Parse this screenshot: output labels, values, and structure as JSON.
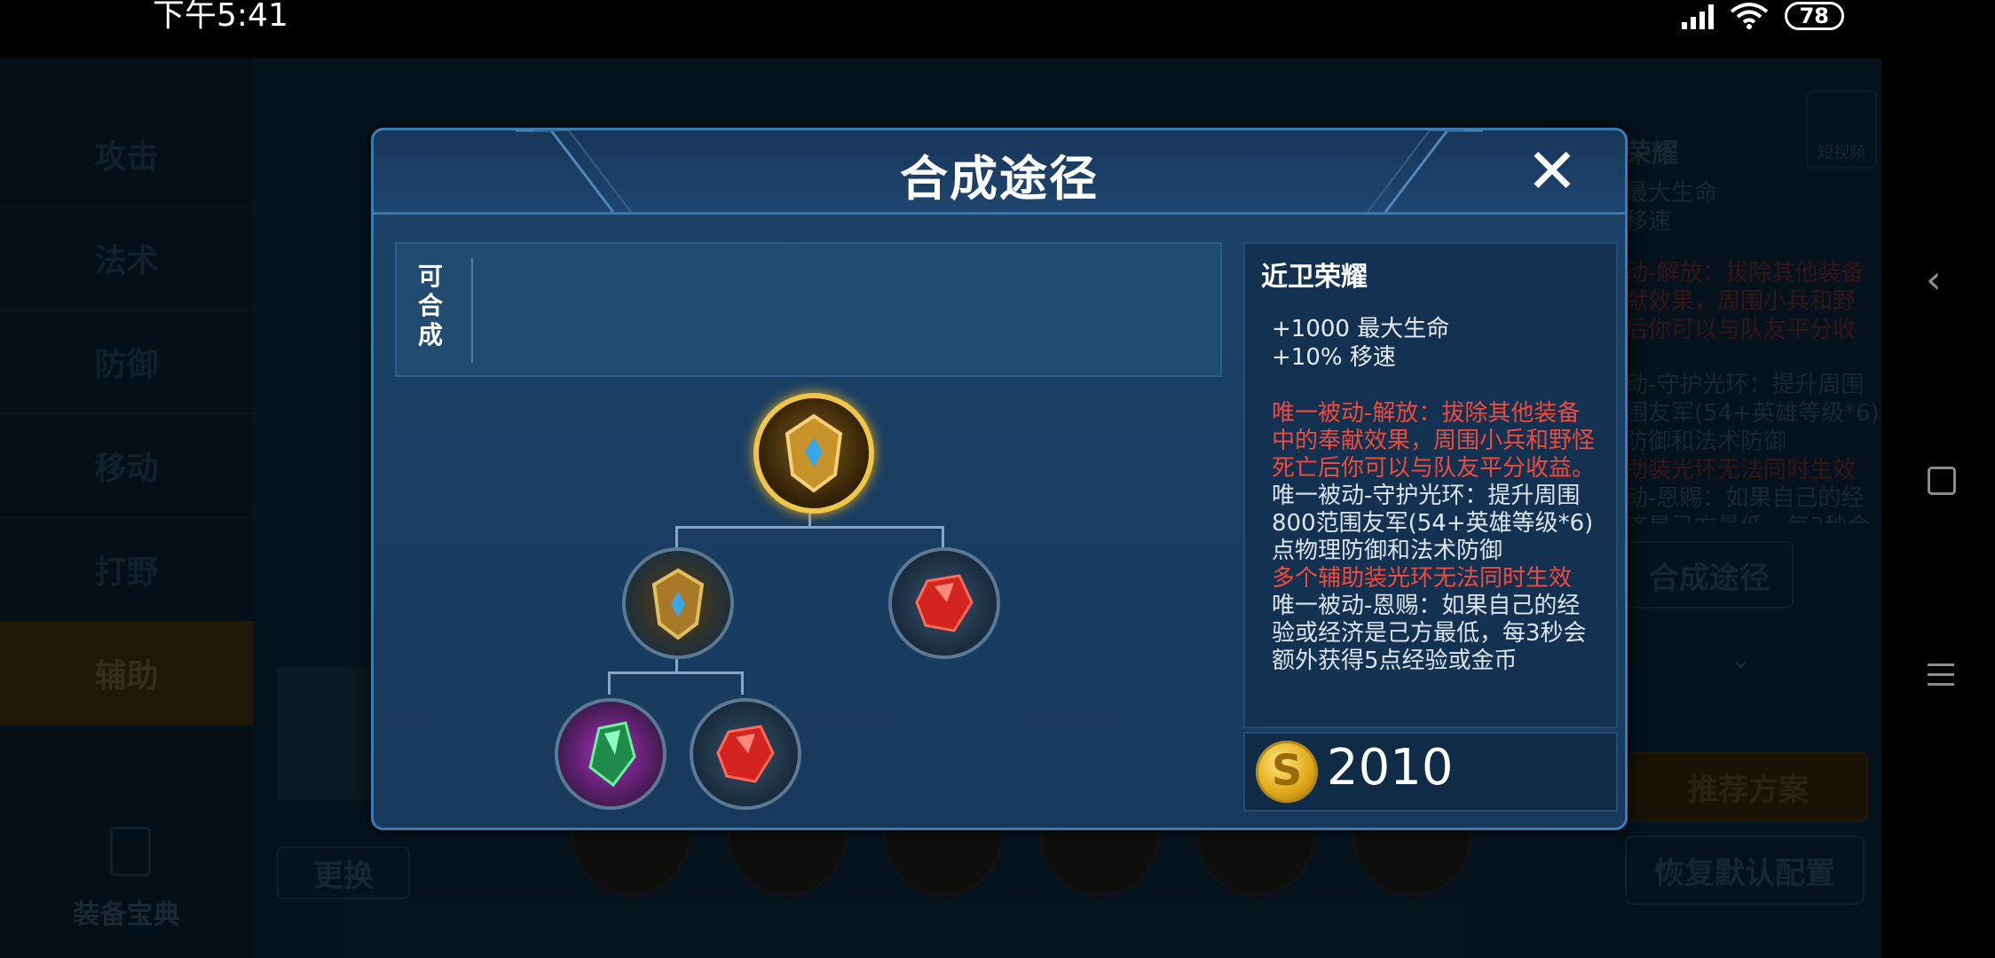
{
  "status_bar": {
    "time": "下午5:41",
    "network": "HD",
    "battery": "78"
  },
  "background": {
    "categories": [
      "攻击",
      "法术",
      "防御",
      "移动",
      "打野",
      "辅助"
    ],
    "active_category": "辅助",
    "equipment_codex_label": "装备宝典",
    "replace_button": "更换",
    "right_panel": {
      "video_label": "短视频",
      "item_name_partial": "荣耀",
      "stat_lines": [
        "最大生命",
        "移速"
      ],
      "desc_red": [
        "动-解放：拔除其他装备",
        "献效果，周围小兵和野",
        "后你可以与队友平分收"
      ],
      "desc_white": [
        "动-守护光环：提升周围",
        "围友军(54+英雄等级*6)",
        "防御和法术防御"
      ],
      "desc_red2": "助装光环无法同时生效",
      "desc_white2": [
        "动-恩赐：如果自己的经",
        "济是己方最低，每3秒会"
      ],
      "craft_path_button": "合成途径",
      "recommend_button": "推荐方案",
      "restore_button": "恢复默认配置"
    }
  },
  "modal": {
    "title": "合成途径",
    "craftable_label": "可合成",
    "item": {
      "name": "近卫荣耀",
      "stats": [
        "+1000 最大生命",
        "+10% 移速"
      ],
      "passive1": "唯一被动-解放：拔除其他装备中的奉献效果，周围小兵和野怪死亡后你可以与队友平分收益。",
      "passive2": "唯一被动-守护光环：提升周围800范围友军(54+英雄等级*6)点物理防御和法术防御",
      "passive2_note": "多个辅助装光环无法同时生效",
      "passive3": "唯一被动-恩赐：如果自己的经验或经济是己方最低，每3秒会额外获得5点经验或金币",
      "price": "2010",
      "coin_symbol": "S"
    },
    "tree_icons": [
      "golden-shield-icon",
      "gold-crest-icon",
      "red-gem-icon",
      "green-crystal-icon",
      "red-gem-icon"
    ]
  },
  "colors": {
    "modal_bg": "#1b3f63",
    "modal_border": "#3b7db3",
    "passive_red": "#f04b3b",
    "gold": "#e0a81a"
  }
}
